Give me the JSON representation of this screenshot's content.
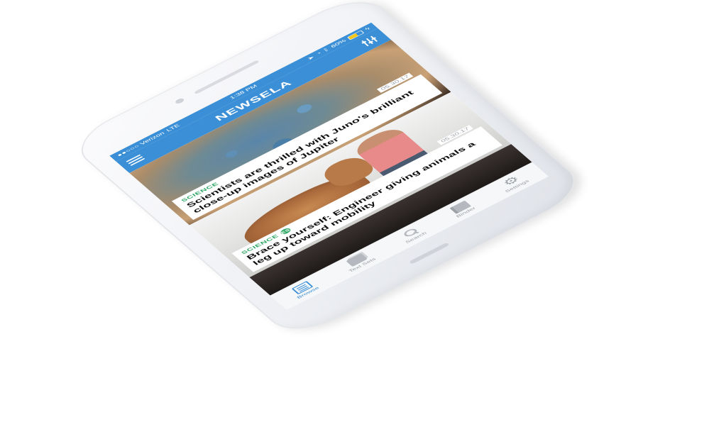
{
  "status_bar": {
    "carrier": "●●○○○ Verizon",
    "network": "LTE",
    "time": "1:38 PM",
    "battery": "60%",
    "icons": [
      "location-icon",
      "alarm-icon",
      "bluetooth-icon",
      "battery-icon",
      "charging-icon"
    ]
  },
  "nav": {
    "title": "NEWSELA",
    "menu_icon": "list-icon",
    "filter_icon": "sliders-icon"
  },
  "articles": [
    {
      "date": "05.30.17",
      "category": "SCIENCE",
      "badge": "",
      "title": "Scientists are thrilled with Juno's brilliant close-up images of Jupiter"
    },
    {
      "date": "05.30.17",
      "category": "SCIENCE",
      "badge": "ES",
      "title": "Brace yourself: Engineer giving animals a leg up toward mobility"
    }
  ],
  "tabs": [
    {
      "label": "Browse",
      "icon": "browse-icon",
      "active": true
    },
    {
      "label": "Text Sets",
      "icon": "text-sets-icon",
      "active": false
    },
    {
      "label": "Search",
      "icon": "search-icon",
      "active": false
    },
    {
      "label": "Binder",
      "icon": "binder-icon",
      "active": false
    },
    {
      "label": "Settings",
      "icon": "gear-icon",
      "active": false
    }
  ],
  "colors": {
    "brand_blue": "#3a8fd6",
    "category_green": "#2fa866"
  }
}
